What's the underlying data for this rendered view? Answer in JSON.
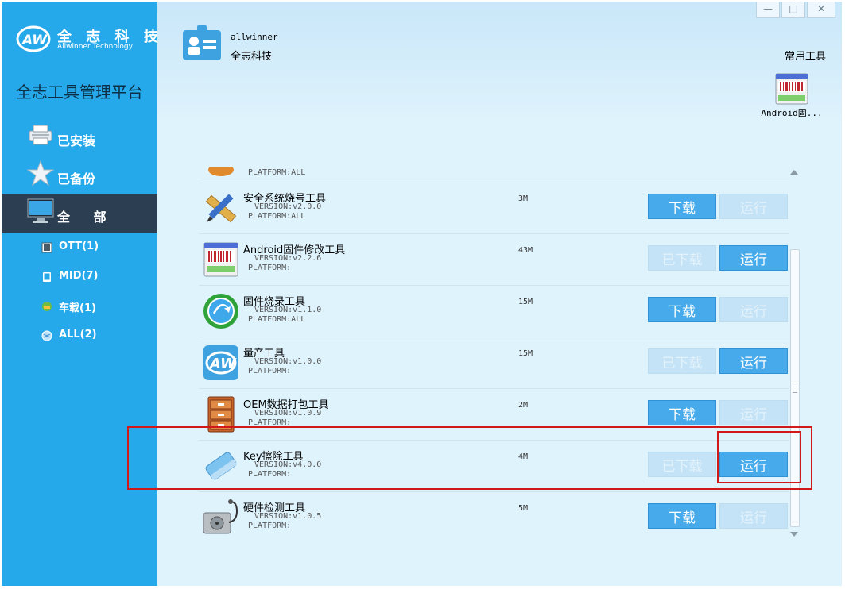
{
  "sidebar": {
    "logo_cn": "全 志 科 技",
    "logo_en": "Allwinner Technology",
    "platform_title": "全志工具管理平台",
    "nav": [
      {
        "label": "已安装",
        "icon": "printer-icon"
      },
      {
        "label": "已备份",
        "icon": "star-icon"
      },
      {
        "label": "全 部",
        "icon": "monitor-icon"
      }
    ],
    "categories": [
      {
        "label": "OTT(1)",
        "icon": "tv-icon"
      },
      {
        "label": "MID(7)",
        "icon": "tablet-icon"
      },
      {
        "label": "车载(1)",
        "icon": "car-icon"
      },
      {
        "label": "ALL(2)",
        "icon": "globe-icon"
      }
    ]
  },
  "header": {
    "org_name": "allwinner",
    "org_sub": "全志科技",
    "common_tools_title": "常用工具",
    "common_tool_label": "Android固...",
    "window_buttons": [
      "—",
      "□",
      "✕"
    ]
  },
  "tools": [
    {
      "name": "",
      "version": "",
      "platform": "PLATFORM:ALL",
      "size": "",
      "download": "",
      "run": ""
    },
    {
      "name": "安全系统烧号工具",
      "version": "VERSION:v2.0.0",
      "platform": "PLATFORM:ALL",
      "size": "3M",
      "download": "下载",
      "run": "运行",
      "downloaded": false
    },
    {
      "name": "Android固件修改工具",
      "version": "VERSION:v2.2.6",
      "platform": "PLATFORM:",
      "size": "43M",
      "download": "已下载",
      "run": "运行",
      "downloaded": true
    },
    {
      "name": "固件烧录工具",
      "version": "VERSION:v1.1.0",
      "platform": "PLATFORM:ALL",
      "size": "15M",
      "download": "下载",
      "run": "运行",
      "downloaded": false
    },
    {
      "name": "量产工具",
      "version": "VERSION:v1.0.0",
      "platform": "PLATFORM:",
      "size": "15M",
      "download": "已下载",
      "run": "运行",
      "downloaded": true
    },
    {
      "name": "OEM数据打包工具",
      "version": "VERSION:v1.0.9",
      "platform": "PLATFORM:",
      "size": "2M",
      "download": "下载",
      "run": "运行",
      "downloaded": false
    },
    {
      "name": "Key擦除工具",
      "version": "VERSION:v4.0.0",
      "platform": "PLATFORM:",
      "size": "4M",
      "download": "已下载",
      "run": "运行",
      "downloaded": true
    },
    {
      "name": "硬件检测工具",
      "version": "VERSION:v1.0.5",
      "platform": "PLATFORM:",
      "size": "5M",
      "download": "下载",
      "run": "运行",
      "downloaded": false
    }
  ],
  "colors": {
    "sidebar": "#26a9ea",
    "sidebar_active": "#2c3f52",
    "button_active": "#47aaea",
    "button_disabled": "#c4e3f7",
    "highlight": "#d11919"
  }
}
